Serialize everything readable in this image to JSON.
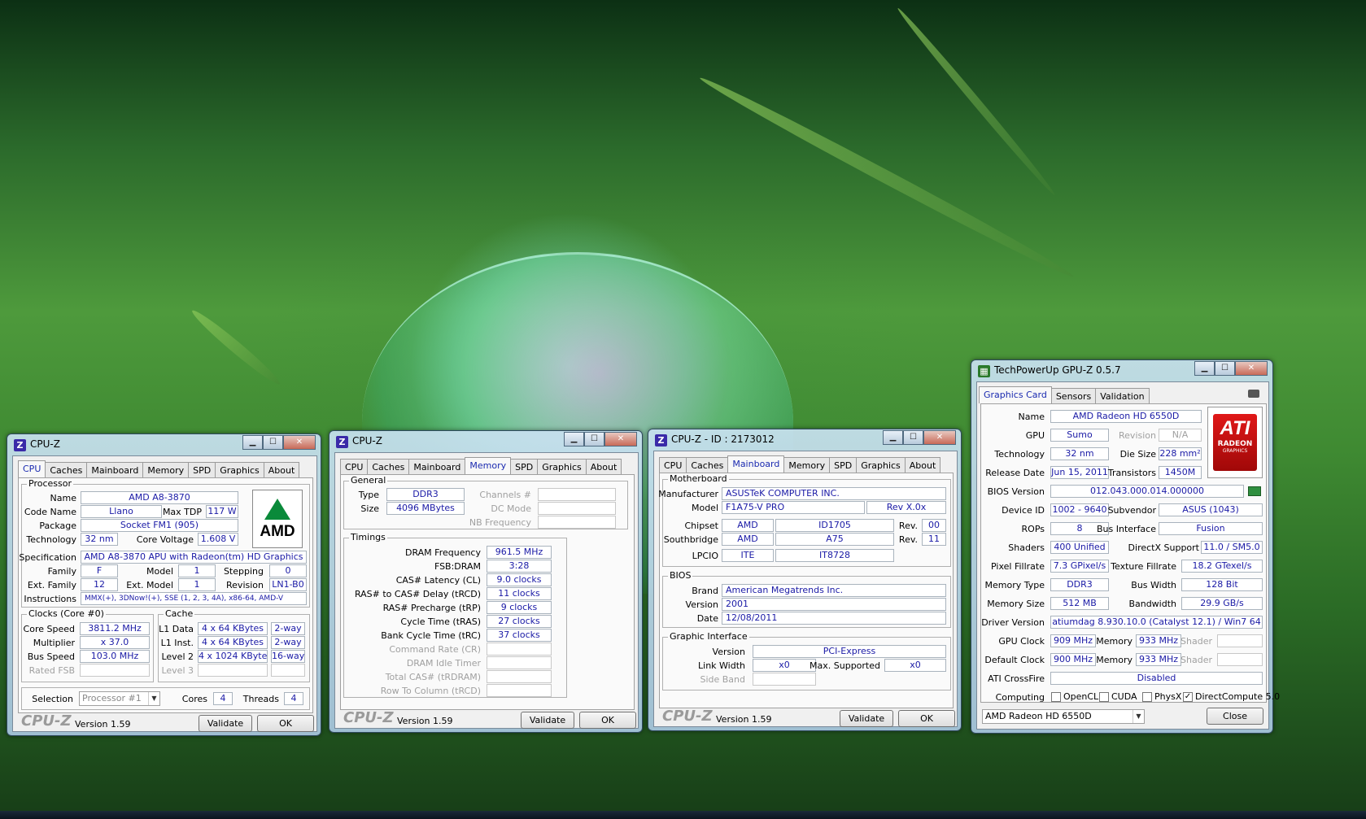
{
  "cpuz1": {
    "title": "CPU-Z",
    "tabs": [
      "CPU",
      "Caches",
      "Mainboard",
      "Memory",
      "SPD",
      "Graphics",
      "About"
    ],
    "processor_label": "Processor",
    "name_label": "Name",
    "name": "AMD A8-3870",
    "codename_label": "Code Name",
    "codename": "Llano",
    "maxtdp_label": "Max TDP",
    "maxtdp": "117 W",
    "package_label": "Package",
    "package": "Socket FM1 (905)",
    "technology_label": "Technology",
    "technology": "32 nm",
    "corevoltage_label": "Core Voltage",
    "corevoltage": "1.608 V",
    "spec_label": "Specification",
    "spec": "AMD A8-3870 APU with Radeon(tm) HD Graphics",
    "family_label": "Family",
    "family": "F",
    "model_label": "Model",
    "model": "1",
    "stepping_label": "Stepping",
    "stepping": "0",
    "extfamily_label": "Ext. Family",
    "extfamily": "12",
    "extmodel_label": "Ext. Model",
    "extmodel": "1",
    "revision_label": "Revision",
    "revision": "LN1-B0",
    "instructions_label": "Instructions",
    "instructions": "MMX(+), 3DNow!(+), SSE (1, 2, 3, 4A), x86-64, AMD-V",
    "clocks_label": "Clocks (Core #0)",
    "corespeed_label": "Core Speed",
    "corespeed": "3811.2 MHz",
    "multiplier_label": "Multiplier",
    "multiplier": "x 37.0",
    "busspeed_label": "Bus Speed",
    "busspeed": "103.0 MHz",
    "ratedfsb_label": "Rated FSB",
    "cache_label": "Cache",
    "l1data_label": "L1 Data",
    "l1data": "4 x 64 KBytes",
    "l1data_way": "2-way",
    "l1inst_label": "L1 Inst.",
    "l1inst": "4 x 64 KBytes",
    "l1inst_way": "2-way",
    "level2_label": "Level 2",
    "level2": "4 x 1024 KBytes",
    "level2_way": "16-way",
    "level3_label": "Level 3",
    "selection_label": "Selection",
    "selection": "Processor #1",
    "cores_label": "Cores",
    "cores": "4",
    "threads_label": "Threads",
    "threads": "4",
    "logo_text": "AMD",
    "brand": "CPU-Z",
    "version": "Version 1.59",
    "validate": "Validate",
    "ok": "OK"
  },
  "cpuz2": {
    "title": "CPU-Z",
    "tabs": [
      "CPU",
      "Caches",
      "Mainboard",
      "Memory",
      "SPD",
      "Graphics",
      "About"
    ],
    "general_label": "General",
    "type_label": "Type",
    "type": "DDR3",
    "size_label": "Size",
    "size": "4096 MBytes",
    "channels_label": "Channels #",
    "dcmode_label": "DC Mode",
    "nbfreq_label": "NB Frequency",
    "timings_label": "Timings",
    "dramfreq_label": "DRAM Frequency",
    "dramfreq": "961.5 MHz",
    "fsbdram_label": "FSB:DRAM",
    "fsbdram": "3:28",
    "cl_label": "CAS# Latency (CL)",
    "cl": "9.0 clocks",
    "trcd_label": "RAS# to CAS# Delay (tRCD)",
    "trcd": "11 clocks",
    "trp_label": "RAS# Precharge (tRP)",
    "trp": "9 clocks",
    "tras_label": "Cycle Time (tRAS)",
    "tras": "27 clocks",
    "trc_label": "Bank Cycle Time (tRC)",
    "trc": "37 clocks",
    "cr_label": "Command Rate (CR)",
    "idle_label": "DRAM Idle Timer",
    "trdram_label": "Total CAS# (tRDRAM)",
    "trcd2_label": "Row To Column (tRCD)",
    "brand": "CPU-Z",
    "version": "Version 1.59",
    "validate": "Validate",
    "ok": "OK"
  },
  "cpuz3": {
    "title": "CPU-Z - ID : 2173012",
    "tabs": [
      "CPU",
      "Caches",
      "Mainboard",
      "Memory",
      "SPD",
      "Graphics",
      "About"
    ],
    "motherboard_label": "Motherboard",
    "manufacturer_label": "Manufacturer",
    "manufacturer": "ASUSTeK COMPUTER INC.",
    "model_label": "Model",
    "model": "F1A75-V PRO",
    "model_rev": "Rev X.0x",
    "chipset_label": "Chipset",
    "chipset_vendor": "AMD",
    "chipset": "ID1705",
    "rev_label": "Rev.",
    "chipset_rev": "00",
    "southbridge_label": "Southbridge",
    "southbridge_vendor": "AMD",
    "southbridge": "A75",
    "southbridge_rev": "11",
    "lpcio_label": "LPCIO",
    "lpcio_vendor": "ITE",
    "lpcio": "IT8728",
    "bios_label": "BIOS",
    "brand_label": "Brand",
    "bios_brand": "American Megatrends Inc.",
    "version_label": "Version",
    "bios_version": "2001",
    "date_label": "Date",
    "bios_date": "12/08/2011",
    "graphic_label": "Graphic Interface",
    "gi_version_label": "Version",
    "gi_version": "PCI-Express",
    "linkwidth_label": "Link Width",
    "linkwidth": "x0",
    "maxsupported_label": "Max. Supported",
    "maxsupported": "x0",
    "sideband_label": "Side Band",
    "brand": "CPU-Z",
    "version": "Version 1.59",
    "validate": "Validate",
    "ok": "OK"
  },
  "gpuz": {
    "title": "TechPowerUp GPU-Z 0.5.7",
    "tabs": [
      "Graphics Card",
      "Sensors",
      "Validation"
    ],
    "name_label": "Name",
    "name": "AMD Radeon HD 6550D",
    "gpu_label": "GPU",
    "gpu": "Sumo",
    "revision_label": "Revision",
    "revision": "N/A",
    "technology_label": "Technology",
    "technology": "32 nm",
    "diesize_label": "Die Size",
    "diesize": "228 mm²",
    "releasedate_label": "Release Date",
    "releasedate": "Jun 15, 2011",
    "transistors_label": "Transistors",
    "transistors": "1450M",
    "bios_label": "BIOS Version",
    "bios": "012.043.000.014.000000",
    "deviceid_label": "Device ID",
    "deviceid": "1002 - 9640",
    "subvendor_label": "Subvendor",
    "subvendor": "ASUS (1043)",
    "rops_label": "ROPs",
    "rops": "8",
    "businterface_label": "Bus Interface",
    "businterface": "Fusion",
    "shaders_label": "Shaders",
    "shaders": "400 Unified",
    "directx_label": "DirectX Support",
    "directx": "11.0 / SM5.0",
    "pixelfill_label": "Pixel Fillrate",
    "pixelfill": "7.3 GPixel/s",
    "texturefill_label": "Texture Fillrate",
    "texturefill": "18.2 GTexel/s",
    "memtype_label": "Memory Type",
    "memtype": "DDR3",
    "buswidth_label": "Bus Width",
    "buswidth": "128 Bit",
    "memsize_label": "Memory Size",
    "memsize": "512 MB",
    "bandwidth_label": "Bandwidth",
    "bandwidth": "29.9 GB/s",
    "driver_label": "Driver Version",
    "driver": "atiumdag 8.930.10.0 (Catalyst 12.1) / Win7 64",
    "gpuclock_label": "GPU Clock",
    "gpuclock": "909 MHz",
    "memory_label": "Memory",
    "memclock": "933 MHz",
    "shader_label": "Shader",
    "defaultclock_label": "Default Clock",
    "defaultclock": "900 MHz",
    "defmemclock": "933 MHz",
    "crossfire_label": "ATI CrossFire",
    "crossfire": "Disabled",
    "computing_label": "Computing",
    "opencl": "OpenCL",
    "cuda": "CUDA",
    "physx": "PhysX",
    "directcompute": "DirectCompute 5.0",
    "checkmark": "✓",
    "device_select": "AMD Radeon HD 6550D",
    "close": "Close",
    "logo_big": "ATI",
    "logo_radeon": "RADEON",
    "logo_graphics": "GRAPHICS"
  }
}
